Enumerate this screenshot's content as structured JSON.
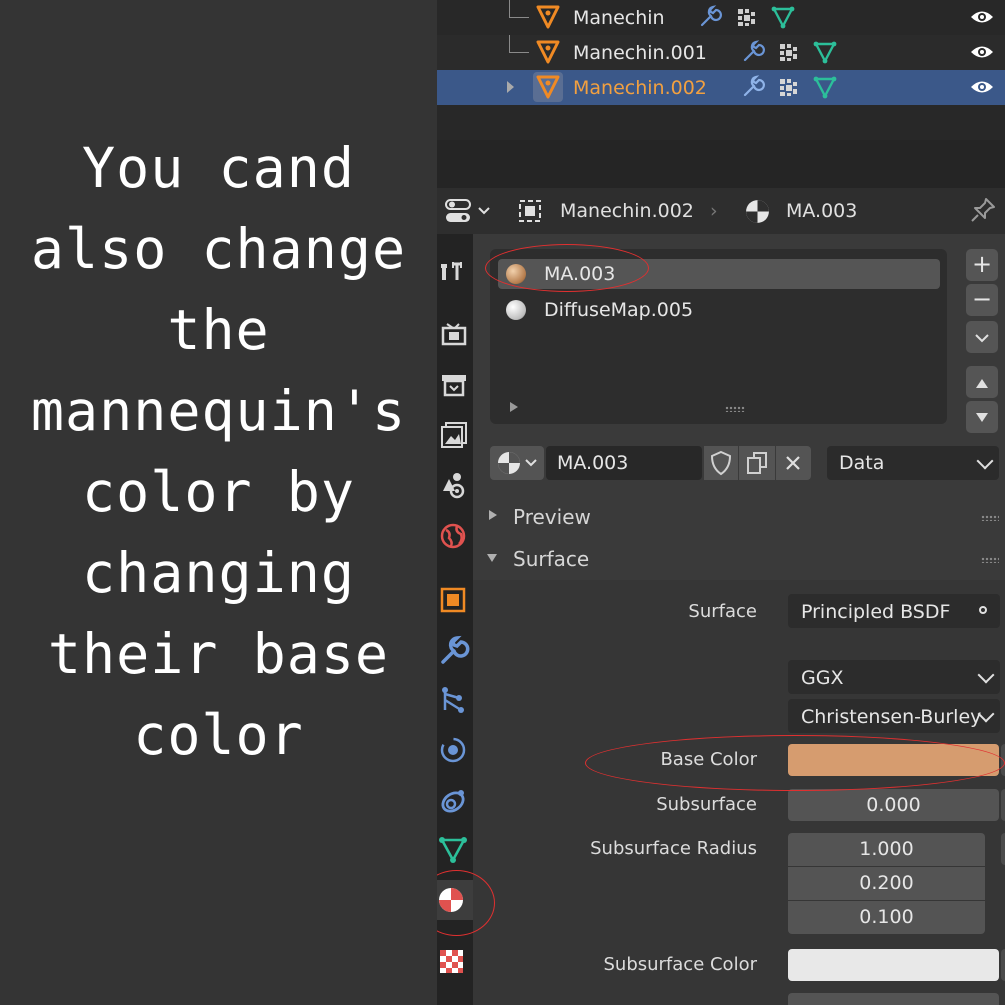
{
  "caption": "You cand also change the mannequin's color by changing their base color",
  "outliner": {
    "rows": [
      {
        "name": "Manechin"
      },
      {
        "name": "Manechin.001"
      },
      {
        "name": "Manechin.002",
        "selected": true
      }
    ]
  },
  "header": {
    "object": "Manechin.002",
    "material": "MA.003"
  },
  "material_slots": [
    {
      "name": "MA.003",
      "color": "#c89b6d",
      "selected": true
    },
    {
      "name": "DiffuseMap.005",
      "color": "#e8e8e8",
      "selected": false
    }
  ],
  "material": {
    "name": "MA.003",
    "link": "Data"
  },
  "sections": {
    "preview": "Preview",
    "surface": "Surface"
  },
  "props": {
    "surface_label": "Surface",
    "surface_value": "Principled BSDF",
    "distribution": "GGX",
    "subsurface_method": "Christensen-Burley",
    "base_color_label": "Base Color",
    "base_color": "#d69c6f",
    "subsurface_label": "Subsurface",
    "subsurface_value": "0.000",
    "subsurface_radius_label": "Subsurface Radius",
    "subsurface_radius": [
      "1.000",
      "0.200",
      "0.100"
    ],
    "subsurface_color_label": "Subsurface Color",
    "subsurface_color": "#e8e8e8"
  },
  "colors": {
    "selection": "#3b5889",
    "active_name": "#f2a040",
    "annotation": "#e03030",
    "object_icon": "#f08a24",
    "mesh_icon": "#2cbf9a",
    "modifier_icon": "#6a95d6"
  }
}
